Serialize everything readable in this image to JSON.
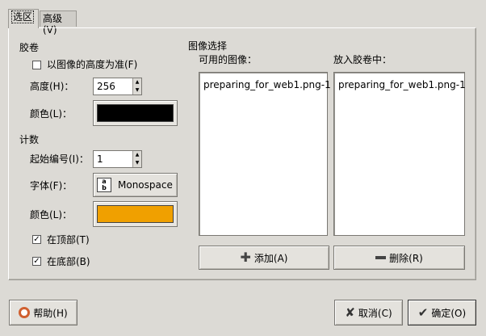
{
  "tabs": [
    {
      "label": "选区",
      "active": true
    },
    {
      "label": "高级(V)",
      "active": false
    }
  ],
  "film": {
    "section_title": "胶卷",
    "fit_height_label": "以图像的高度为准(F)",
    "fit_height_checked": false,
    "height_label": "高度(H)：",
    "height_value": "256",
    "color_label": "颜色(L)：",
    "color_value": "#000000"
  },
  "numbering": {
    "section_title": "计数",
    "start_index_label": "起始编号(I)：",
    "start_index_value": "1",
    "font_label": "字体(F)：",
    "font_value": "Monospace",
    "color_label": "颜色(L)：",
    "color_value": "#f0a000",
    "at_top_label": "在顶部(T)",
    "at_top_checked": true,
    "at_bottom_label": "在底部(B)",
    "at_bottom_checked": true
  },
  "images": {
    "section_title": "图像选择",
    "available_label": "可用的图像：",
    "available_items": [
      "preparing_for_web1.png-1"
    ],
    "on_film_label": "放入胶卷中：",
    "on_film_items": [
      "preparing_for_web1.png-1"
    ],
    "add_label": "添加(A)",
    "remove_label": "删除(R)"
  },
  "footer": {
    "help_label": "帮助(H)",
    "cancel_label": "取消(C)",
    "ok_label": "确定(O)"
  },
  "icons": {
    "add": "plus-icon",
    "remove": "minus-icon",
    "help": "lifebuoy-icon",
    "cancel": "x-icon",
    "ok": "checkmark-icon",
    "font": "font-icon"
  }
}
